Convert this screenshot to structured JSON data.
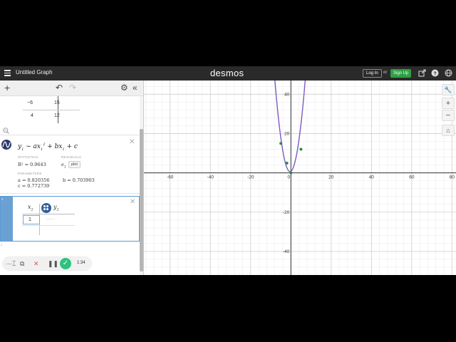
{
  "header": {
    "title": "Untitled Graph",
    "brand": "desmos",
    "login_label": "Log In",
    "or_text": "or",
    "signup_label": "Sign Up",
    "icons": [
      "share-icon",
      "help-icon",
      "globe-icon"
    ]
  },
  "toolbar": {
    "add_icon": "+",
    "undo_icon": "↶",
    "redo_icon": "↷",
    "settings_icon": "⚙",
    "collapse_icon": "«"
  },
  "table1": {
    "rows": [
      {
        "x": "−6",
        "y": "15"
      },
      {
        "x": "4",
        "y": "12"
      }
    ]
  },
  "regression": {
    "formula_text": "y1 ~ ax1^2 + bx1 + c",
    "statistics_label": "STATISTICS",
    "r2": "R² = 0.9643",
    "residuals_label": "RESIDUALS",
    "residual_var": "e1",
    "plot_label": "plot",
    "parameters_label": "PARAMETERS",
    "a": "a = 0.820356",
    "b": "b = 0.703903",
    "c": "c = 0.772739"
  },
  "table2": {
    "row_number": "3",
    "col1": "x",
    "col1_sub": "2",
    "col2": "y",
    "col2_sub": "2",
    "input_value": "1"
  },
  "row4_number": "4",
  "video": {
    "time": "1:34"
  },
  "graph": {
    "x_ticks": [
      "-60",
      "-40",
      "-20",
      "0",
      "20",
      "40",
      "60",
      "80"
    ],
    "y_ticks": [
      "40",
      "20",
      "-20",
      "-40"
    ],
    "curve_color": "#7b5bbf",
    "point_color": "#2d8a4b"
  },
  "chart_data": {
    "type": "scatter",
    "xlim": [
      -73,
      82
    ],
    "ylim": [
      -52,
      47
    ],
    "tick_values_x": [
      -60,
      -40,
      -20,
      0,
      20,
      40,
      60,
      80
    ],
    "tick_values_y": [
      40,
      20,
      -20,
      -40
    ],
    "curve": {
      "a": 0.820356,
      "b": 0.703903,
      "c": 0.772739
    },
    "points": [
      {
        "x": -5,
        "y": 15
      },
      {
        "x": -2,
        "y": 5
      },
      {
        "x": 0,
        "y": 0
      },
      {
        "x": 5,
        "y": 12
      }
    ],
    "grid": true
  }
}
